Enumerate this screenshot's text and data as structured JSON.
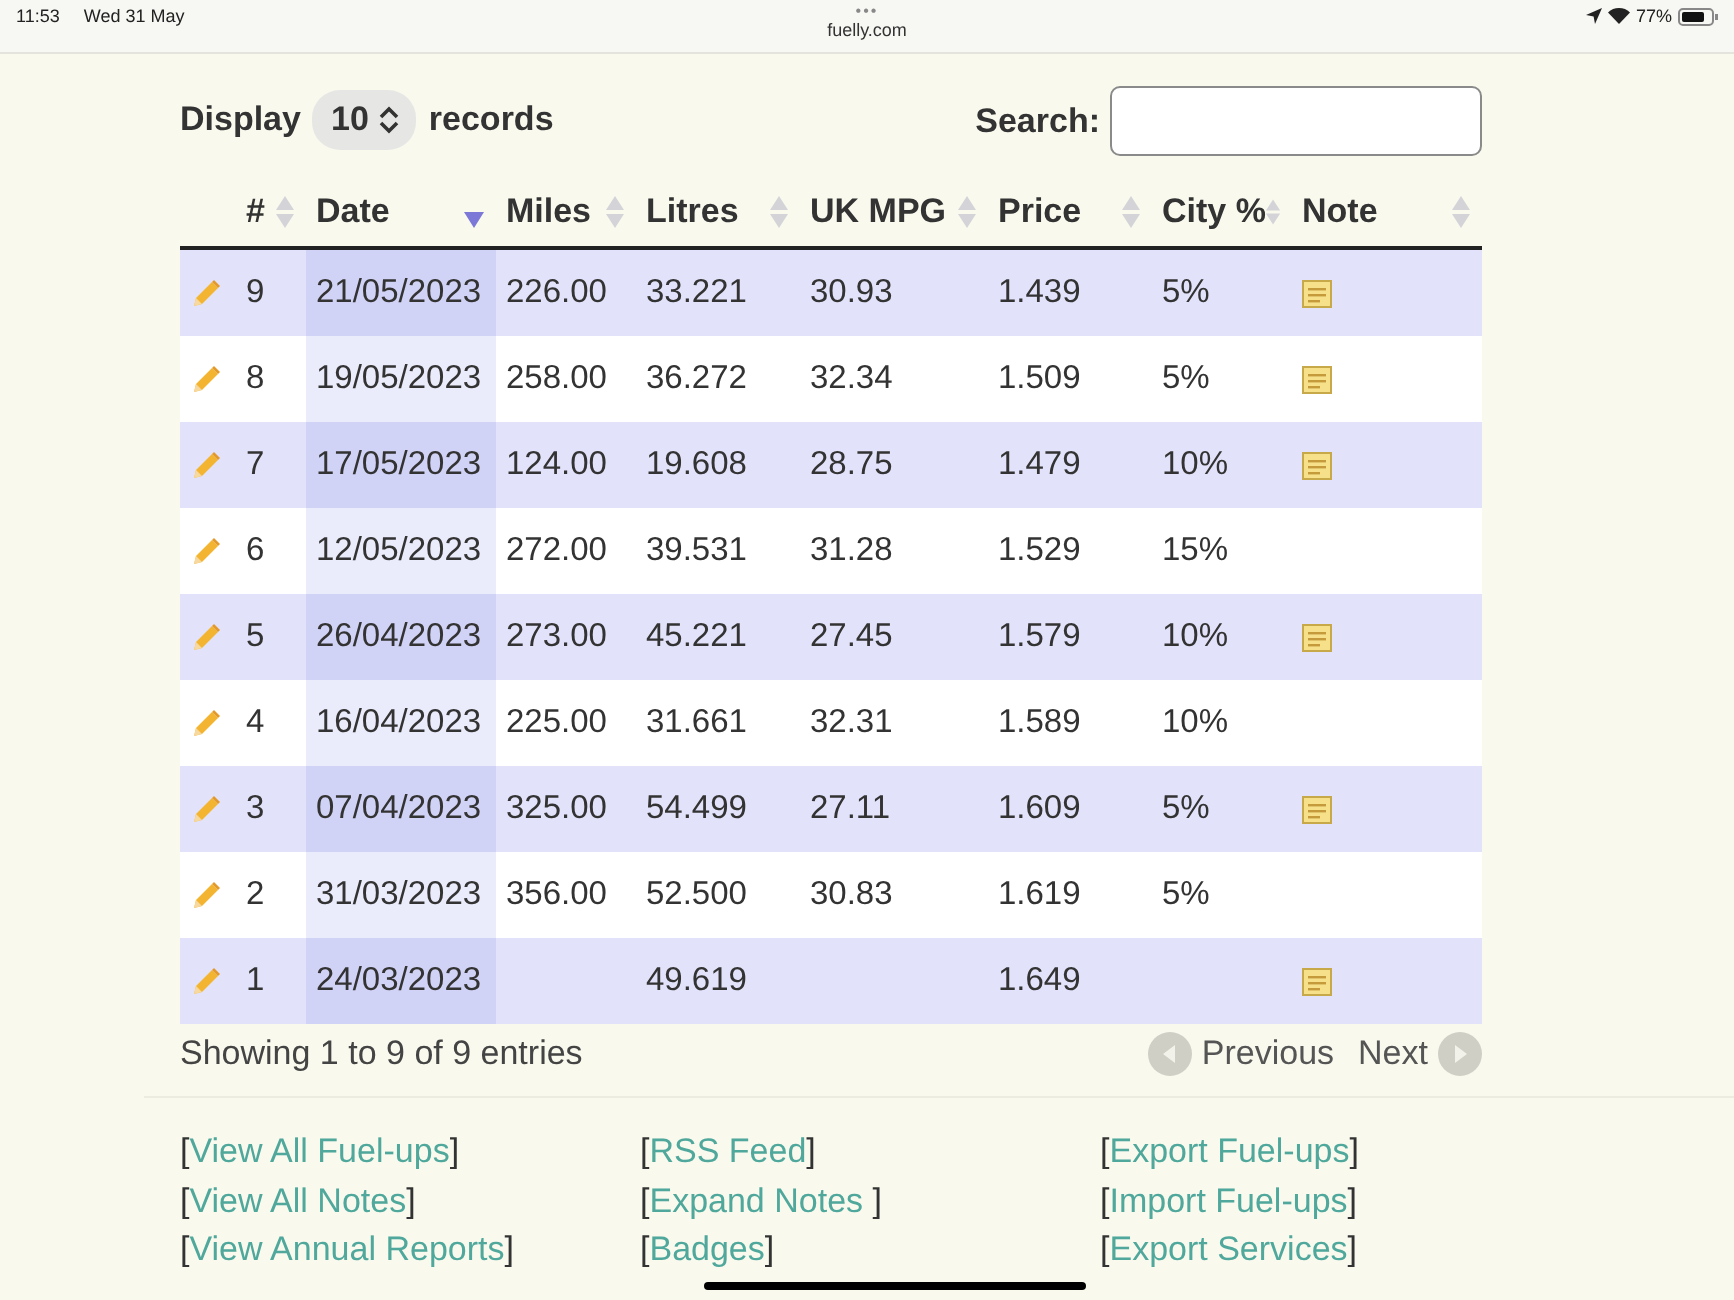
{
  "status_bar": {
    "time": "11:53",
    "date": "Wed 31 May",
    "dots": "•••",
    "url": "fuelly.com",
    "battery": "77%"
  },
  "controls": {
    "display_label": "Display",
    "page_size": "10",
    "records_label": "records",
    "search_label": "Search:"
  },
  "table": {
    "columns": [
      {
        "label": "#",
        "sorted": false
      },
      {
        "label": "Date",
        "sorted": true
      },
      {
        "label": "Miles",
        "sorted": false
      },
      {
        "label": "Litres",
        "sorted": false
      },
      {
        "label": "UK MPG",
        "sorted": false
      },
      {
        "label": "Price",
        "sorted": false
      },
      {
        "label": "City %",
        "sorted": false
      },
      {
        "label": "Note",
        "sorted": false
      }
    ],
    "rows": [
      {
        "num": "9",
        "date": "21/05/2023",
        "miles": "226.00",
        "litres": "33.221",
        "mpg": "30.93",
        "price": "1.439",
        "city": "5%",
        "note": true
      },
      {
        "num": "8",
        "date": "19/05/2023",
        "miles": "258.00",
        "litres": "36.272",
        "mpg": "32.34",
        "price": "1.509",
        "city": "5%",
        "note": true
      },
      {
        "num": "7",
        "date": "17/05/2023",
        "miles": "124.00",
        "litres": "19.608",
        "mpg": "28.75",
        "price": "1.479",
        "city": "10%",
        "note": true
      },
      {
        "num": "6",
        "date": "12/05/2023",
        "miles": "272.00",
        "litres": "39.531",
        "mpg": "31.28",
        "price": "1.529",
        "city": "15%",
        "note": false
      },
      {
        "num": "5",
        "date": "26/04/2023",
        "miles": "273.00",
        "litres": "45.221",
        "mpg": "27.45",
        "price": "1.579",
        "city": "10%",
        "note": true
      },
      {
        "num": "4",
        "date": "16/04/2023",
        "miles": "225.00",
        "litres": "31.661",
        "mpg": "32.31",
        "price": "1.589",
        "city": "10%",
        "note": false
      },
      {
        "num": "3",
        "date": "07/04/2023",
        "miles": "325.00",
        "litres": "54.499",
        "mpg": "27.11",
        "price": "1.609",
        "city": "5%",
        "note": true
      },
      {
        "num": "2",
        "date": "31/03/2023",
        "miles": "356.00",
        "litres": "52.500",
        "mpg": "30.83",
        "price": "1.619",
        "city": "5%",
        "note": false
      },
      {
        "num": "1",
        "date": "24/03/2023",
        "litres": "49.619",
        "price": "1.649",
        "note": true
      }
    ]
  },
  "info": "Showing 1 to 9 of 9 entries",
  "pager": {
    "previous": "Previous",
    "next": "Next"
  },
  "footer": {
    "open": "[",
    "close": "]",
    "columns": [
      [
        "View All Fuel-ups",
        "View All Notes",
        "View Annual Reports"
      ],
      [
        "RSS Feed",
        "Expand Notes ",
        "Badges"
      ],
      [
        "Export Fuel-ups",
        "Import Fuel-ups",
        "Export Services"
      ]
    ]
  }
}
